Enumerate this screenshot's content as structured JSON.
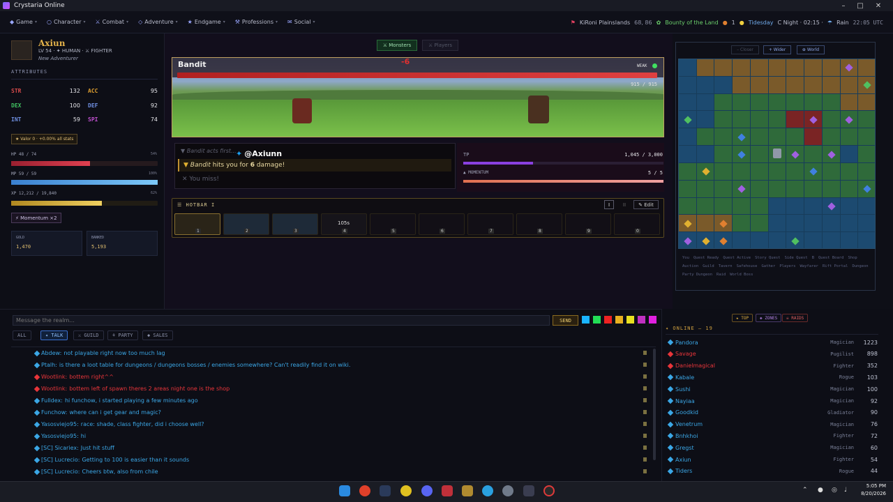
{
  "window": {
    "title": "Crystaria Online"
  },
  "nav": {
    "items": [
      {
        "label": "Game",
        "icon": "diamond-icon"
      },
      {
        "label": "Character",
        "icon": "person-icon"
      },
      {
        "label": "Combat",
        "icon": "swords-icon"
      },
      {
        "label": "Adventure",
        "icon": "compass-icon"
      },
      {
        "label": "Endgame",
        "icon": "star-icon"
      },
      {
        "label": "Professions",
        "icon": "hammer-icon"
      },
      {
        "label": "Social",
        "icon": "chat-icon"
      }
    ],
    "location": "KiRoni Plainslands",
    "coords": "68, 86",
    "buff": "Bounty of the Land",
    "buff_count": "1",
    "tide": "Tidesday",
    "time_of_day": "C Night · 02:15 ·",
    "weather": "Rain",
    "clock": "22:05 UTC"
  },
  "character": {
    "name": "Axiun",
    "level_line": "LV 54 · ✦ HUMAN · ⚔ FIGHTER",
    "title": "New Adventurer",
    "attributes_header": "ATTRIBUTES",
    "stats": [
      {
        "label": "STR",
        "value": "132"
      },
      {
        "label": "ACC",
        "value": "95"
      },
      {
        "label": "DEX",
        "value": "100"
      },
      {
        "label": "DEF",
        "value": "92"
      },
      {
        "label": "INT",
        "value": "59"
      },
      {
        "label": "SPI",
        "value": "74"
      }
    ],
    "valor": "★ Valor 0 · +0.00% all stats",
    "hp_label": "HP 48 / 74",
    "hp_pct_label": "54%",
    "hp_fraction": 0.54,
    "mp_label": "MP 59 / 59",
    "mp_pct_label": "100%",
    "mp_fraction": 1.0,
    "xp_label": "XP 12,212 / 19,840",
    "xp_pct_label": "62%",
    "xp_fraction": 0.62,
    "momentum_badge": "⚡ Momentum ×2",
    "gold_label": "GOLD",
    "gold_value": "1,470",
    "banked_label": "BANKED",
    "banked_value": "5,193"
  },
  "battle": {
    "tab_monsters": "⚔ Monsters",
    "tab_players": "⚔ Players",
    "enemy_name": "Bandit",
    "damage_popup": "-6",
    "weak_label": "WEAK",
    "enemy_hp": "915 / 915",
    "log": [
      "Bandit acts first...",
      "Bandit hits you for 6 damage!",
      "✕ You miss!"
    ],
    "log_highlight_name": "Bandit",
    "log_highlight_mid": " hits you for ",
    "log_highlight_num": "6",
    "log_highlight_end": " damage!",
    "watermark": "@Axiunn",
    "tp_label": "TP",
    "tp_value": "1,045 / 3,000",
    "tp_fraction": 0.35,
    "momentum_label": "▲ MOMENTUM",
    "momentum_value": "5 / 5",
    "momentum_fraction": 1.0
  },
  "hotbar": {
    "title": "☰ HOTBAR I",
    "page1": "I",
    "page2": "II",
    "edit": "✎ Edit",
    "slots": [
      "1",
      "2",
      "3",
      "4",
      "5",
      "6",
      "7",
      "8",
      "9",
      "0"
    ],
    "cooldown": "105s"
  },
  "map": {
    "btn_closer": "– Closer",
    "btn_wider": "+ Wider",
    "btn_world": "⊕ World",
    "legend": [
      "You",
      "Quest Ready",
      "Quest Active",
      "Story Quest",
      "Side Quest",
      "B",
      "Quest Board",
      "Shop",
      "Auction",
      "Guild",
      "Tavern",
      "Safehouse",
      "Gather",
      "Players",
      "Wayfarer",
      "Rift Portal",
      "Dungeon",
      "Party Dungeon",
      "Raid",
      "World Boss"
    ]
  },
  "chat": {
    "placeholder": "Message the realm...",
    "send": "SEND",
    "swatches": [
      "#1ab4ff",
      "#22dd55",
      "#ee2222",
      "#e8b020",
      "#e8e020",
      "#c030c0",
      "#e020e0"
    ],
    "tabs": [
      "ALL",
      "✦ TALK",
      "⚔ GUILD",
      "⚘ PARTY",
      "◆ SALES"
    ],
    "lines": [
      {
        "name": "Abdew",
        "text": "not playable right now too much lag",
        "color": "#3ba7e6"
      },
      {
        "name": "Ptalh",
        "text": "is there a loot table for dungeons / dungeons bosses / enemies somewhere? Can't readily find it on wiki.",
        "color": "#3ba7e6"
      },
      {
        "name": "Wootlink",
        "text": "bottem right^^",
        "color": "#e8353a"
      },
      {
        "name": "Wootlink",
        "text": "bottem left of spawn theres 2 areas night one is the shop",
        "color": "#e8353a"
      },
      {
        "name": "Fulldex",
        "text": "hi funchow, i started playing a few minutes ago",
        "color": "#3ba7e6"
      },
      {
        "name": "Funchow",
        "text": "where can i get gear and magic?",
        "color": "#3ba7e6"
      },
      {
        "name": "Yasosviejo95",
        "text": "race: shade, class fighter, did i choose well?",
        "color": "#3ba7e6"
      },
      {
        "name": "Yasosviejo95",
        "text": "hi",
        "color": "#3ba7e6"
      },
      {
        "name": "[SC] Sicariex",
        "text": "Just hit stuff",
        "color": "#3ba7e6"
      },
      {
        "name": "[SC] Lucrecio",
        "text": "Getting to 100 is easier than it sounds",
        "color": "#3ba7e6"
      },
      {
        "name": "[SC] Lucrecio",
        "text": "Cheers btw, also from chile",
        "color": "#3ba7e6"
      }
    ]
  },
  "online": {
    "chip_top": "★ TOP",
    "chip_zones": "◈ ZONES",
    "chip_raids": "☠ RAIDS",
    "header": "✦ ONLINE — 19",
    "players": [
      {
        "name": "Pandora",
        "cls": "Magician",
        "lvl": "1223",
        "color": "#3ba7e6"
      },
      {
        "name": "Savage",
        "cls": "Pugilist",
        "lvl": "898",
        "color": "#e8353a"
      },
      {
        "name": "Danielmagical",
        "cls": "Fighter",
        "lvl": "352",
        "color": "#e8353a"
      },
      {
        "name": "Kabale",
        "cls": "Rogue",
        "lvl": "103",
        "color": "#3ba7e6"
      },
      {
        "name": "Sushi",
        "cls": "Magician",
        "lvl": "100",
        "color": "#3ba7e6"
      },
      {
        "name": "Nayiaa",
        "cls": "Magician",
        "lvl": "92",
        "color": "#3ba7e6"
      },
      {
        "name": "Goodkid",
        "cls": "Gladiator",
        "lvl": "90",
        "color": "#3ba7e6"
      },
      {
        "name": "Venetrum",
        "cls": "Magician",
        "lvl": "76",
        "color": "#3ba7e6"
      },
      {
        "name": "Bnhkhoi",
        "cls": "Fighter",
        "lvl": "72",
        "color": "#3ba7e6"
      },
      {
        "name": "Gregst",
        "cls": "Magician",
        "lvl": "60",
        "color": "#3ba7e6"
      },
      {
        "name": "Axiun",
        "cls": "Fighter",
        "lvl": "54",
        "color": "#3ba7e6"
      },
      {
        "name": "Tiders",
        "cls": "Rogue",
        "lvl": "44",
        "color": "#3ba7e6"
      }
    ]
  },
  "taskbar": {
    "time": "5:05 PM",
    "date": "8/20/2026"
  }
}
